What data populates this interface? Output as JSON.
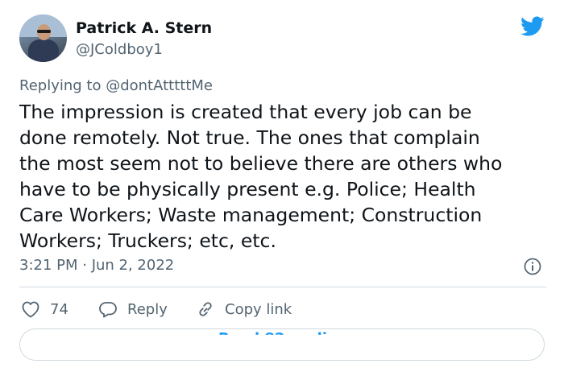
{
  "author": {
    "name": "Patrick A. Stern",
    "handle": "@JColdboy1"
  },
  "tweet": {
    "replying_to": "Replying to @dontAtttttMe",
    "text": "The impression is created that every job can be\ndone remotely. Not true. The ones that complain\nthe most seem not to believe there are others who\nhave to be physically present e.g. Police; Health\nCare Workers; Waste management; Construction\nWorkers; Truckers; etc, etc.",
    "timestamp": "3:21 PM · Jun 2, 2022"
  },
  "actions": {
    "like_count": "74",
    "reply_label": "Reply",
    "copy_link_label": "Copy link"
  },
  "colors": {
    "brand": "#1d9bf0",
    "muted": "#536471",
    "text": "#0f1419"
  },
  "icons": [
    "twitter-bird-icon",
    "info-icon",
    "heart-icon",
    "reply-icon",
    "link-icon"
  ]
}
